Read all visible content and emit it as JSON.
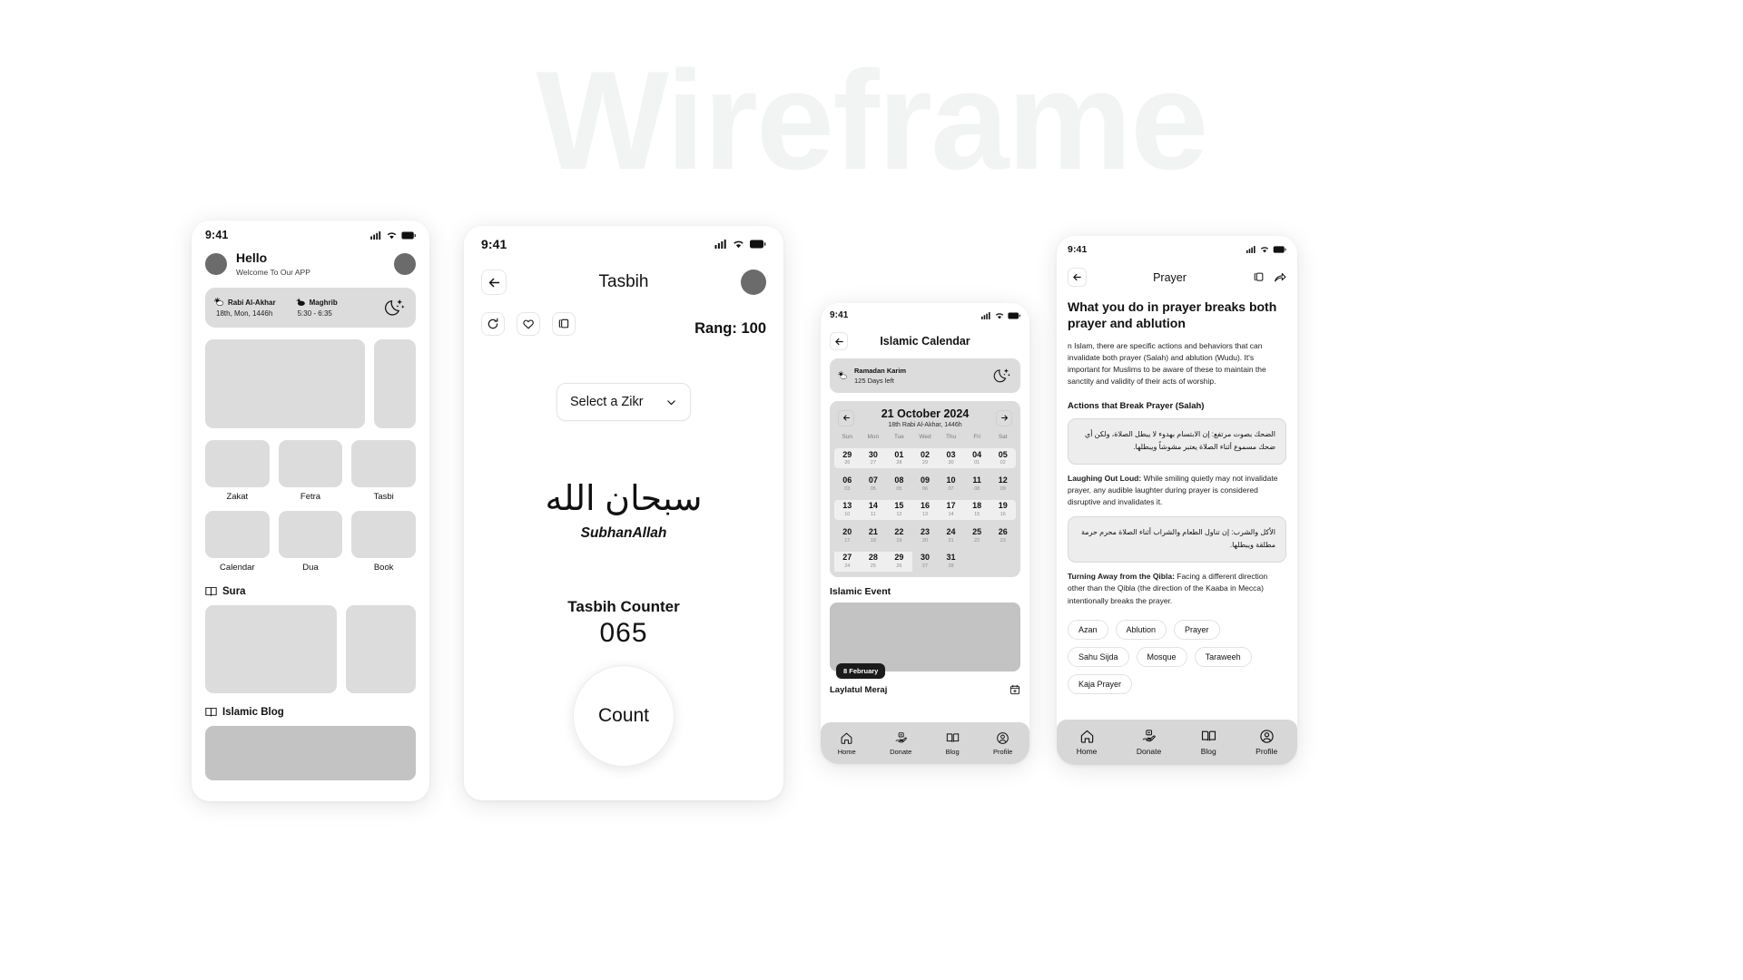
{
  "watermark": "Wireframe",
  "status": {
    "time": "9:41"
  },
  "phone_home": {
    "greeting_title": "Hello",
    "greeting_sub": "Welcome To Our APP",
    "info": {
      "month_name": "Rabi Al-Akhar",
      "month_date": "18th, Mon, 1446h",
      "prayer_name": "Maghrib",
      "prayer_time": "5:30 - 6:35"
    },
    "tiles_row1": [
      "Zakat",
      "Fetra",
      "Tasbi"
    ],
    "tiles_row2": [
      "Calendar",
      "Dua",
      "Book"
    ],
    "section_sura": "Sura",
    "section_blog": "Islamic Blog"
  },
  "phone_tasbih": {
    "title": "Tasbih",
    "rang": "Rang: 100",
    "tools": [
      "refresh-icon",
      "heart-icon",
      "copy-icon"
    ],
    "select_zikr": "Select a Zikr",
    "arabic": "سبحان الله",
    "transliteration": "SubhanAllah",
    "counter_label": "Tasbih Counter",
    "counter_value": "065",
    "count_button": "Count"
  },
  "phone_calendar": {
    "title": "Islamic Calendar",
    "ramadan_name": "Ramadan Karim",
    "ramadan_sub": "125 Days left",
    "month_title": "21 October 2024",
    "hijri_sub": "18th Rabi Al-Akhar, 1446h",
    "dow": [
      "Sun",
      "Mon",
      "Tue",
      "Wed",
      "Thu",
      "Fri",
      "Sat"
    ],
    "weeks": [
      {
        "highlight": true,
        "days": [
          [
            "29",
            "26"
          ],
          [
            "30",
            "27"
          ],
          [
            "01",
            "28"
          ],
          [
            "02",
            "29"
          ],
          [
            "03",
            "30"
          ],
          [
            "04",
            "01"
          ],
          [
            "05",
            "02"
          ]
        ]
      },
      {
        "highlight": false,
        "days": [
          [
            "06",
            "03"
          ],
          [
            "07",
            "05"
          ],
          [
            "08",
            "05"
          ],
          [
            "09",
            "06"
          ],
          [
            "10",
            "07"
          ],
          [
            "11",
            "08"
          ],
          [
            "12",
            "09"
          ]
        ]
      },
      {
        "highlight": true,
        "days": [
          [
            "13",
            "10"
          ],
          [
            "14",
            "11"
          ],
          [
            "15",
            "12"
          ],
          [
            "16",
            "13"
          ],
          [
            "17",
            "14"
          ],
          [
            "18",
            "15"
          ],
          [
            "19",
            "16"
          ]
        ]
      },
      {
        "highlight": false,
        "days": [
          [
            "20",
            "17"
          ],
          [
            "21",
            "18"
          ],
          [
            "22",
            "19"
          ],
          [
            "23",
            "20"
          ],
          [
            "24",
            "21"
          ],
          [
            "25",
            "22"
          ],
          [
            "26",
            "23"
          ]
        ]
      },
      {
        "highlight": true,
        "hlspan": 3,
        "days": [
          [
            "27",
            "24"
          ],
          [
            "28",
            "25"
          ],
          [
            "29",
            "26"
          ],
          [
            "30",
            "27"
          ],
          [
            "31",
            "28"
          ],
          [
            "",
            ""
          ],
          [
            "",
            ""
          ]
        ]
      }
    ],
    "event_heading": "Islamic Event",
    "event_badge": "8 February",
    "event_name": "Laylatul Meraj",
    "nav": [
      {
        "label": "Home",
        "icon": "home-icon"
      },
      {
        "label": "Donate",
        "icon": "donate-icon"
      },
      {
        "label": "Blog",
        "icon": "book-icon"
      },
      {
        "label": "Profile",
        "icon": "profile-icon"
      }
    ]
  },
  "phone_prayer": {
    "title": "Prayer",
    "heading": "What you do in prayer breaks both prayer and ablution",
    "intro": "n Islam, there are specific actions and behaviors that can invalidate both prayer (Salah) and ablution (Wudu). It's important for Muslims to be aware of these to maintain the sanctity and validity of their acts of worship.",
    "sub_heading": "Actions that Break Prayer (Salah)",
    "arabic_1": "الضحك بصوت مرتفع: إن الابتسام بهدوء لا يبطل الصلاة، ولكن أي ضحك مسموع أثناء الصلاة يعتبر مشوشاً ويبطلها.",
    "para_1_bold": "Laughing Out Loud:",
    "para_1": " While smiling quietly may not invalidate prayer, any audible laughter during prayer is considered disruptive and invalidates it.",
    "arabic_2": "الأكل والشرب: إن تناول الطعام والشراب أثناء الصلاة محرم حرمة مطلقة ويبطلها.",
    "para_2_bold": "Turning Away from the Qibla:",
    "para_2": " Facing a different direction other than the Qibla (the direction of the Kaaba in Mecca) intentionally breaks the prayer.",
    "chips": [
      "Azan",
      "Ablution",
      "Prayer",
      "Sahu Sijda",
      "Mosque",
      "Taraweeh",
      "Kaja Prayer"
    ],
    "nav": [
      {
        "label": "Home",
        "icon": "home-icon"
      },
      {
        "label": "Donate",
        "icon": "donate-icon"
      },
      {
        "label": "Blog",
        "icon": "book-icon"
      },
      {
        "label": "Profile",
        "icon": "profile-icon"
      }
    ]
  },
  "colors": {
    "skeleton": "#dcdcdc",
    "card": "#dcdcdc",
    "navbar": "#d7d7d7",
    "accent": "#1b1b1b"
  }
}
